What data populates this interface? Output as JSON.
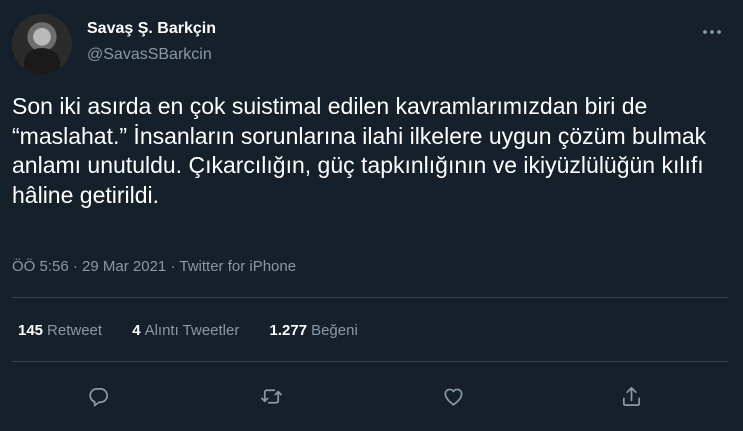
{
  "user": {
    "display_name": "Savaş Ş. Barkçin",
    "handle": "@SavasSBarkcin",
    "avatar_icon": "avatar-photo"
  },
  "tweet": {
    "text": "Son iki asırda en çok suistimal edilen kavramlarımızdan biri de “maslahat.” İnsanların sorunlarına ilahi ilkelere uygun çözüm bulmak anlamı unutuldu. Çıkarcılığın, güç tapkınlığının ve ikiyüzlülüğün kılıfı hâline getirildi.",
    "time": "ÖÖ 5:56",
    "separator": "·",
    "date": "29 Mar 2021",
    "source": "Twitter for iPhone"
  },
  "stats": {
    "retweets_count": "145",
    "retweets_label": "Retweet",
    "quotes_count": "4",
    "quotes_label": "Alıntı Tweetler",
    "likes_count": "1.277",
    "likes_label": "Beğeni"
  },
  "actions": {
    "reply_icon": "reply-icon",
    "retweet_icon": "retweet-icon",
    "like_icon": "heart-icon",
    "share_icon": "share-icon"
  },
  "colors": {
    "background": "#15202b",
    "text_primary": "#ffffff",
    "text_secondary": "#8899a6",
    "divider": "#38444d"
  }
}
